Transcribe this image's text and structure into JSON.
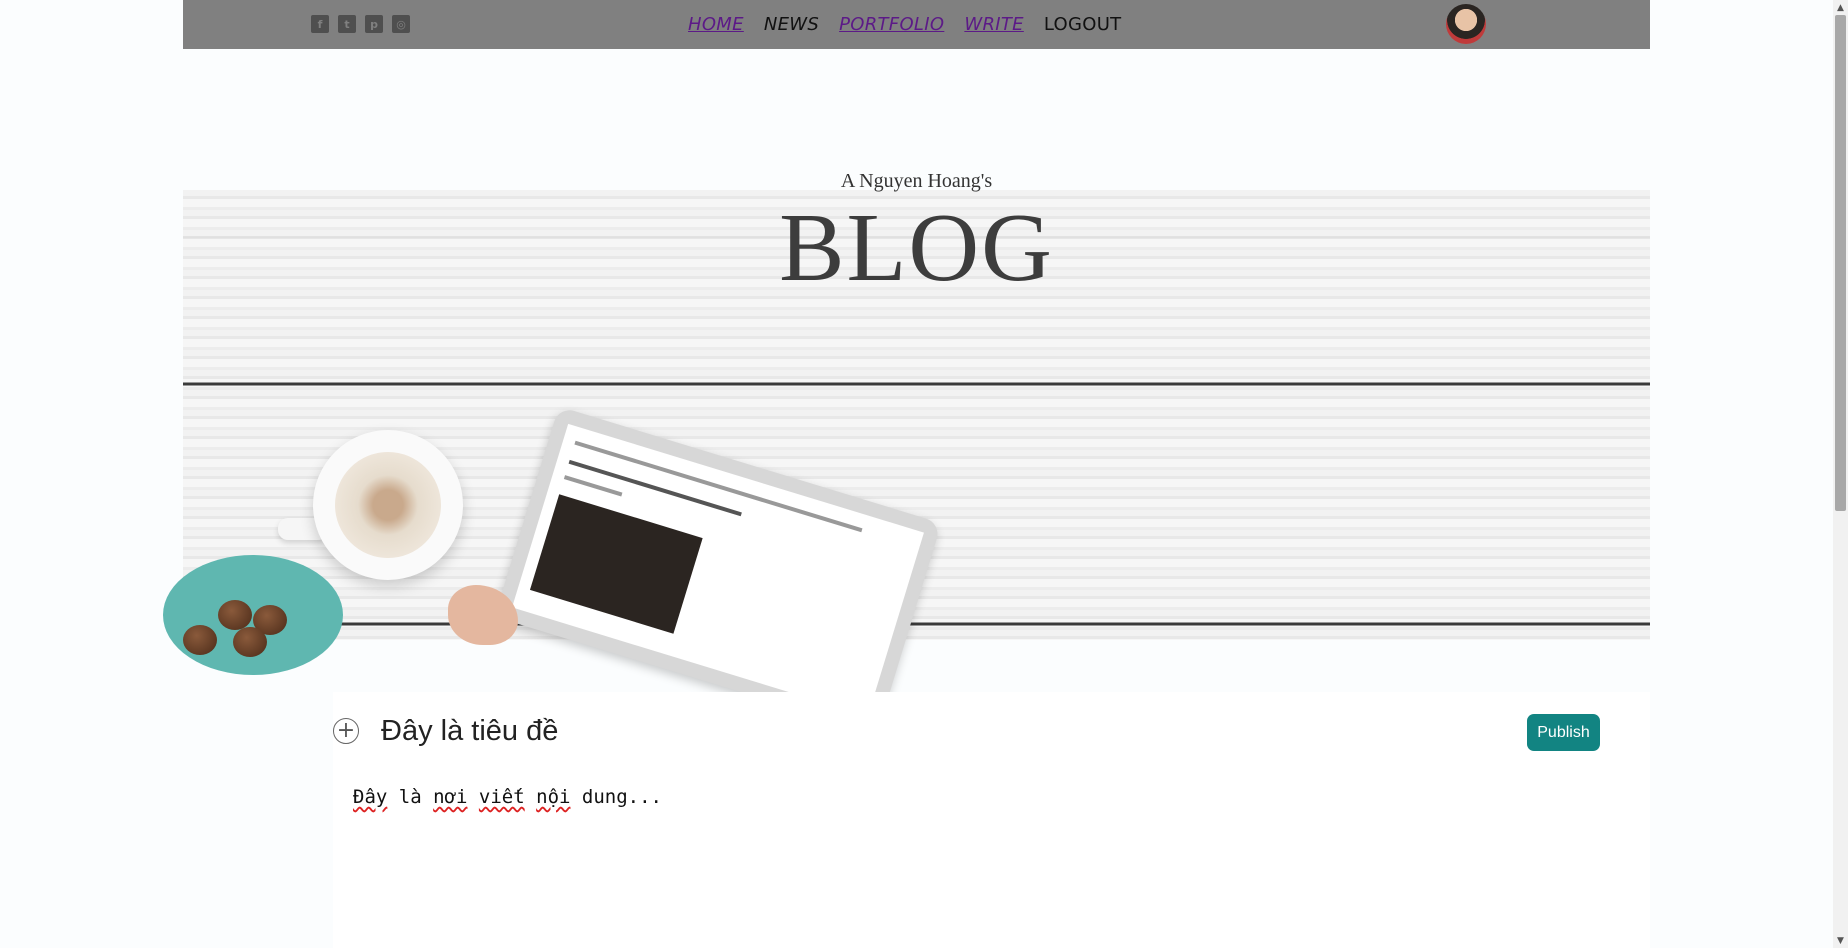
{
  "nav": {
    "socials": [
      {
        "icon": "facebook-icon",
        "glyph": "f"
      },
      {
        "icon": "twitter-icon",
        "glyph": "t"
      },
      {
        "icon": "pinterest-icon",
        "glyph": "p"
      },
      {
        "icon": "instagram-icon",
        "glyph": "◎"
      }
    ],
    "links": {
      "home": "HOME",
      "news": "NEWS",
      "portfolio": "PORTFOLIO",
      "write": "WRITE",
      "logout": "LOGOUT"
    }
  },
  "header": {
    "subtitle": "A Nguyen Hoang's",
    "title": "BLOG"
  },
  "editor": {
    "add_glyph": "+",
    "title_value": "Đây là tiêu đề",
    "publish_label": "Publish",
    "content_words": [
      "Đây",
      "là",
      "nơi",
      "viết",
      "nội",
      "dung..."
    ]
  },
  "colors": {
    "navbar": "#808080",
    "visited_link": "#5c1a87",
    "publish_button": "#128482",
    "background": "#fbfdfe"
  },
  "scrollbar": {
    "up_glyph": "▲",
    "down_glyph": "▼"
  }
}
